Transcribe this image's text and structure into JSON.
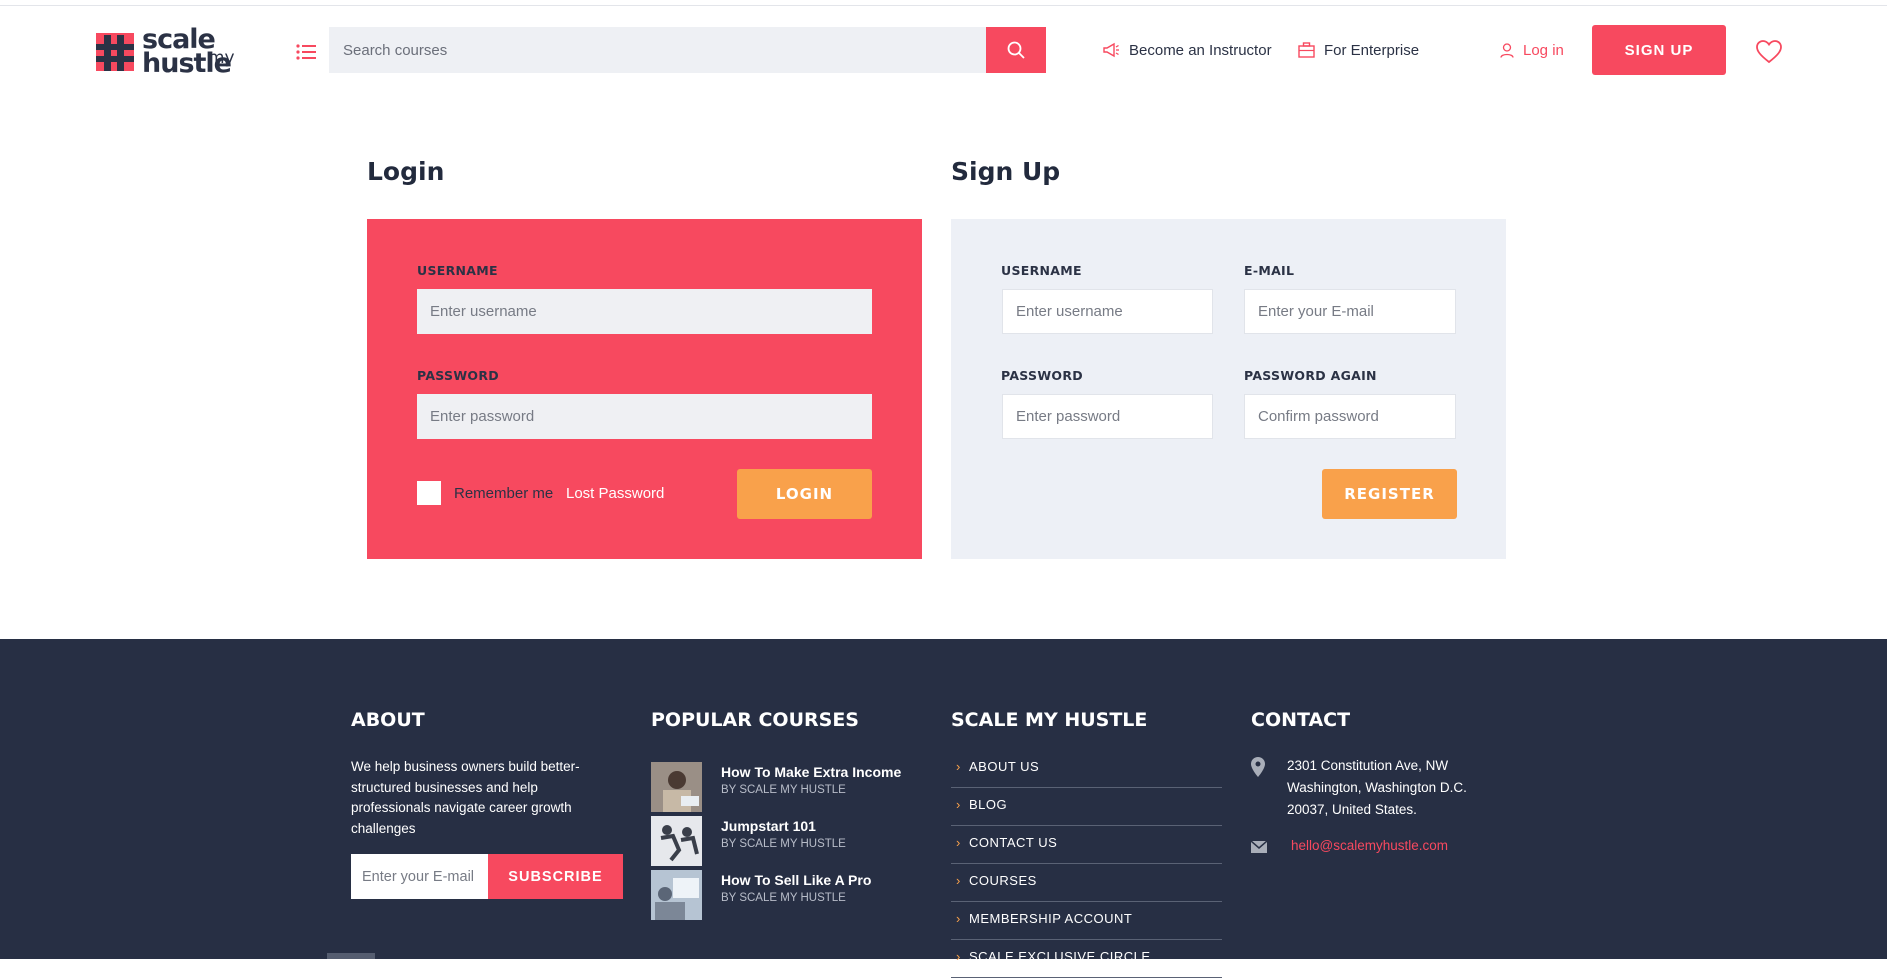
{
  "header": {
    "logo_line1": "scale",
    "logo_my": "my",
    "logo_line2": "hustle",
    "search_placeholder": "Search courses",
    "become_instructor": "Become an Instructor",
    "for_enterprise": "For Enterprise",
    "login_link": "Log in",
    "signup_button": "SIGN UP"
  },
  "login": {
    "title": "Login",
    "username_label": "USERNAME",
    "username_placeholder": "Enter username",
    "password_label": "PASSWORD",
    "password_placeholder": "Enter password",
    "remember_label": "Remember me",
    "lost_password": "Lost Password",
    "submit": "LOGIN"
  },
  "signup": {
    "title": "Sign Up",
    "username_label": "USERNAME",
    "username_placeholder": "Enter username",
    "email_label": "E-MAIL",
    "email_placeholder": "Enter your E-mail",
    "password_label": "PASSWORD",
    "password_placeholder": "Enter password",
    "password_again_label": "PASSWORD AGAIN",
    "password_again_placeholder": "Confirm password",
    "submit": "REGISTER"
  },
  "footer": {
    "about": {
      "title": "ABOUT",
      "text": "We help business owners build better-structured businesses and help professionals navigate career growth challenges",
      "email_placeholder": "Enter your E-mail",
      "subscribe": "SUBSCRIBE"
    },
    "popular": {
      "title": "POPULAR COURSES",
      "courses": [
        {
          "title": "How To Make Extra Income",
          "by": "BY SCALE MY HUSTLE"
        },
        {
          "title": "Jumpstart 101",
          "by": "BY SCALE MY HUSTLE"
        },
        {
          "title": "How To Sell Like A Pro",
          "by": "BY SCALE MY HUSTLE"
        }
      ]
    },
    "links": {
      "title": "SCALE MY HUSTLE",
      "items": [
        "ABOUT US",
        "BLOG",
        "CONTACT US",
        "COURSES",
        "MEMBERSHIP ACCOUNT",
        "SCALE EXCLUSIVE CIRCLE"
      ]
    },
    "contact": {
      "title": "CONTACT",
      "address": "2301 Constitution Ave, NW Washington, Washington D.C. 20037, United States.",
      "email": "hello@scalemyhustle.com"
    }
  },
  "colors": {
    "brand_red": "#f7495f",
    "accent_orange": "#f9a14b",
    "footer_bg": "#272f44",
    "signup_panel_bg": "#edf0f6"
  }
}
